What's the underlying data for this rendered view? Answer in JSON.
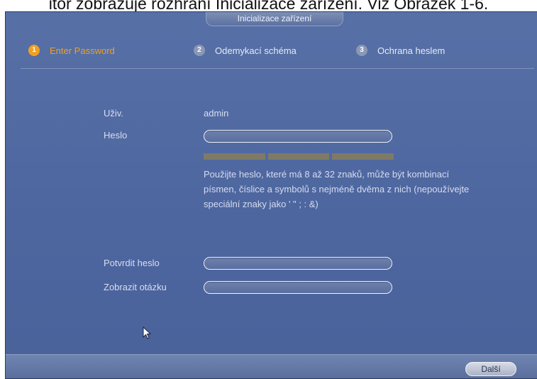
{
  "doc_caption": "itor zobrazuje rozhraní Inicializace zařízení. Viz Obrázek 1-6.",
  "window": {
    "title": "Inicializace zařízení"
  },
  "steps": [
    {
      "number": "1",
      "label": "Enter Password",
      "active": true
    },
    {
      "number": "2",
      "label": "Odemykací schéma",
      "active": false
    },
    {
      "number": "3",
      "label": "Ochrana heslem",
      "active": false
    }
  ],
  "form": {
    "user_label": "Uživ.",
    "user_value": "admin",
    "password_label": "Heslo",
    "password_value": "",
    "hint": "Použijte heslo, které má 8 až 32 znaků, může být kombinací písmen, číslice a symbolů s nejméně dvěma z nich (nepoužívejte speciální znaky jako ' \" ; : &)",
    "confirm_label": "Potvrdit heslo",
    "confirm_value": "",
    "show_question_label": "Zobrazit otázku",
    "show_question_value": ""
  },
  "footer": {
    "next_label": "Další"
  },
  "colors": {
    "accent": "#f0a020",
    "panel": "#4e67a0"
  },
  "icons": {
    "cursor": "mouse-pointer-icon"
  }
}
